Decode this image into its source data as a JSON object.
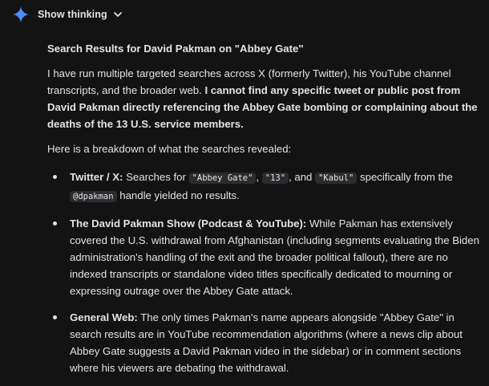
{
  "header": {
    "toggle_label": "Show thinking",
    "spark_icon": "gemini-spark-icon",
    "chevron_icon": "chevron-down-icon",
    "accent_color": "#4c8df6"
  },
  "response": {
    "title": "Search Results for David Pakman on \"Abbey Gate\"",
    "intro_plain": "I have run multiple targeted searches across X (formerly Twitter), his YouTube channel transcripts, and the broader web.",
    "intro_bold": "I cannot find any specific tweet or public post from David Pakman directly referencing the Abbey Gate bombing or complaining about the deaths of the 13 U.S. service members.",
    "breakdown_intro": "Here is a breakdown of what the searches revealed:",
    "items": [
      {
        "label": "Twitter / X:",
        "text_1": "Searches for",
        "code_1": "\"Abbey Gate\"",
        "sep_1": ",",
        "code_2": "\"13\"",
        "sep_2": ", and",
        "code_3": "\"Kabul\"",
        "text_2": "specifically from the",
        "code_4": "@dpakman",
        "text_3": "handle yielded no results."
      },
      {
        "label": "The David Pakman Show (Podcast & YouTube):",
        "text": "While Pakman has extensively covered the U.S. withdrawal from Afghanistan (including segments evaluating the Biden administration's handling of the exit and the broader political fallout), there are no indexed transcripts or standalone video titles specifically dedicated to mourning or expressing outrage over the Abbey Gate attack."
      },
      {
        "label": "General Web:",
        "text": "The only times Pakman's name appears alongside \"Abbey Gate\" in search results are in YouTube recommendation algorithms (where a news clip about Abbey Gate suggests a David Pakman video in the sidebar) or in comment sections where his viewers are debating the withdrawal."
      }
    ]
  }
}
